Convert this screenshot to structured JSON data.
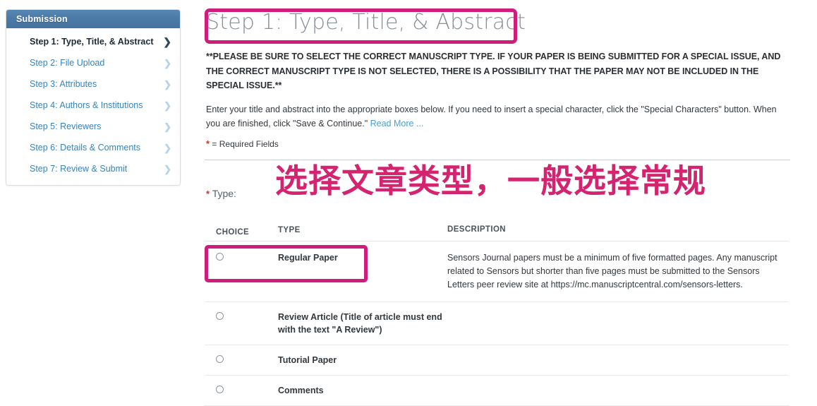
{
  "sidebar": {
    "header": "Submission",
    "items": [
      {
        "label": "Step 1: Type, Title, & Abstract",
        "chevron": "❯",
        "active": true
      },
      {
        "label": "Step 2: File Upload",
        "chevron": "❯",
        "active": false
      },
      {
        "label": "Step 3: Attributes",
        "chevron": "❯",
        "active": false
      },
      {
        "label": "Step 4: Authors & Institutions",
        "chevron": "❯",
        "active": false
      },
      {
        "label": "Step 5: Reviewers",
        "chevron": "❯",
        "active": false
      },
      {
        "label": "Step 6: Details & Comments",
        "chevron": "❯",
        "active": false
      },
      {
        "label": "Step 7: Review & Submit",
        "chevron": "❯",
        "active": false
      }
    ]
  },
  "main": {
    "page_title": "Step 1: Type, Title, & Abstract",
    "warning": "**PLEASE BE SURE TO SELECT THE CORRECT MANUSCRIPT TYPE. IF YOUR PAPER IS BEING SUBMITTED FOR A SPECIAL ISSUE, AND THE CORRECT MANUSCRIPT TYPE IS NOT SELECTED, THERE IS A POSSIBILITY THAT THE PAPER MAY NOT BE INCLUDED IN THE SPECIAL ISSUE.**",
    "intro_text": "Enter your title and abstract into the appropriate boxes below. If you need to insert a special character, click the \"Special Characters\" button. When you are finished, click \"Save & Continue.\" ",
    "read_more_label": "Read More ...",
    "required_star": "*",
    "required_note": "= Required Fields",
    "type_label_star": "*",
    "type_label": "Type:",
    "annotation_cn": "选择文章类型，一般选择常规"
  },
  "table": {
    "headers": {
      "choice": "CHOICE",
      "type": "TYPE",
      "description": "DESCRIPTION"
    },
    "rows": [
      {
        "type": "Regular Paper",
        "description": "Sensors Journal papers must be a minimum of five formatted pages. Any manuscript related to Sensors but shorter than five pages must be submitted to the Sensors Letters peer review site at https://mc.manuscriptcentral.com/sensors-letters."
      },
      {
        "type": "Review Article (Title of article must end with the text \"A Review\")",
        "description": ""
      },
      {
        "type": "Tutorial Paper",
        "description": ""
      },
      {
        "type": "Comments",
        "description": ""
      }
    ]
  },
  "colors": {
    "highlight_pink": "#ce1d7c",
    "annotation_pink": "#d4236f",
    "sidebar_header_blue": "#4b7aa6",
    "link_blue": "#4a9fd4",
    "required_red": "#c0392b"
  }
}
